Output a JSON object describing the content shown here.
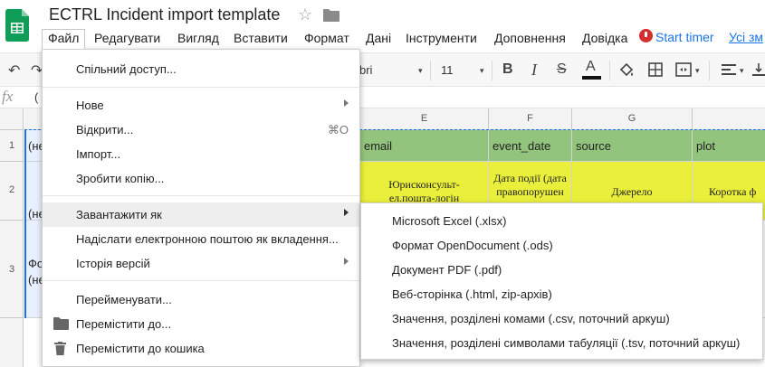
{
  "app": {
    "title": "ECTRL Incident import template",
    "start_timer": "Start timer",
    "all_changes": "Усі зм",
    "brand_color": "#0f9d58",
    "link_color": "#1a73e8"
  },
  "menubar": [
    {
      "label": "Файл",
      "x": 0,
      "active": true
    },
    {
      "label": "Редагувати"
    },
    {
      "label": "Вигляд"
    },
    {
      "label": "Вставити"
    },
    {
      "label": "Формат"
    },
    {
      "label": "Дані"
    },
    {
      "label": "Інструменти"
    },
    {
      "label": "Доповнення"
    },
    {
      "label": "Довідка"
    }
  ],
  "toolbar": {
    "font_name": "bri",
    "font_size": "11",
    "bold": "B",
    "italic": "I",
    "strike": "S",
    "text_color": "A"
  },
  "formula_bar": {
    "fx": "fx",
    "value": "("
  },
  "grid": {
    "columns": [
      "E",
      "F",
      "G"
    ],
    "rows": [
      "1",
      "2",
      "3"
    ],
    "header_cells": [
      "email",
      "event_date",
      "source",
      "plot"
    ],
    "row1_a": "(не",
    "row2_a": "(не",
    "row3_a_line1": "Фо",
    "row3_a_line2": "(не",
    "row2_email_line1": "Юрисконсульт-",
    "row2_email_line2": "ел.пошта-логін",
    "row2_date_line1": "Дата події (дата",
    "row2_date_line2": "правопорушен",
    "row2_source": "Джерело",
    "row2_plot": "Коротка ф"
  },
  "file_menu": {
    "items": [
      {
        "label": "Спільний доступ..."
      },
      {
        "label": "Нове",
        "submenu": true
      },
      {
        "label": "Відкрити...",
        "shortcut": "⌘O"
      },
      {
        "label": "Імпорт..."
      },
      {
        "label": "Зробити копію..."
      },
      {
        "label": "Завантажити як",
        "submenu": true,
        "highlighted": true
      },
      {
        "label": "Надіслати електронною поштою як вкладення..."
      },
      {
        "label": "Історія версій",
        "submenu": true
      },
      {
        "label": "Перейменувати..."
      },
      {
        "label": "Перемістити до...",
        "icon": "folder-icon"
      },
      {
        "label": "Перемістити до кошика",
        "icon": "trash-icon"
      }
    ]
  },
  "download_submenu": {
    "items": [
      {
        "label": "Microsoft Excel (.xlsx)"
      },
      {
        "label": "Формат OpenDocument (.ods)"
      },
      {
        "label": "Документ PDF (.pdf)"
      },
      {
        "label": "Веб-сторінка (.html, zip-архів)"
      },
      {
        "label": "Значення, розділені комами (.csv, поточний аркуш)"
      },
      {
        "label": "Значення, розділені символами табуляції (.tsv, поточний аркуш)"
      }
    ]
  }
}
